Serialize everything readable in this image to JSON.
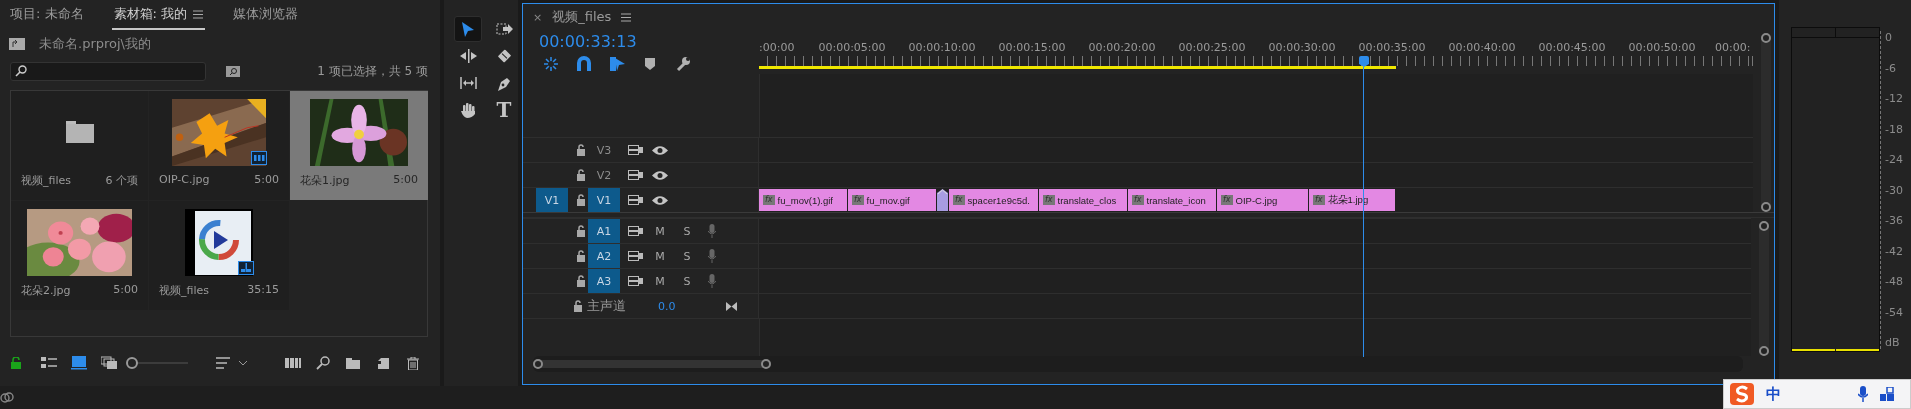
{
  "project_panel": {
    "tabs": [
      {
        "label": "项目: 未命名",
        "selected": false
      },
      {
        "label": "素材箱: 我的",
        "selected": true
      },
      {
        "label": "媒体浏览器",
        "selected": false
      }
    ],
    "path": "未命名.prproj\\我的",
    "selection_count": "1 项已选择，共 5 项",
    "items": [
      {
        "name": "视频_files",
        "info": "6 个项",
        "kind": "folder",
        "selected": false
      },
      {
        "name": "OIP-C.jpg",
        "info": "5:00",
        "kind": "clip",
        "selected": false
      },
      {
        "name": "花朵1.jpg",
        "info": "5:00",
        "selected": true
      },
      {
        "name": "花朵2.jpg",
        "info": "5:00",
        "selected": false
      },
      {
        "name": "视频_files",
        "info": "35:15",
        "kind": "sequence",
        "selected": false
      }
    ],
    "view_buttons": [
      {
        "kind": "list",
        "selected": false
      },
      {
        "kind": "icon",
        "selected": true
      },
      {
        "kind": "freeform",
        "selected": false
      }
    ],
    "zoom_slider": {
      "level": 0
    }
  },
  "tools": [
    {
      "kind": "selection",
      "selected": true
    },
    {
      "kind": "track_select",
      "selected": false
    },
    {
      "kind": "ripple",
      "selected": false
    },
    {
      "kind": "razor",
      "selected": false
    },
    {
      "kind": "slip",
      "selected": false
    },
    {
      "kind": "pen",
      "selected": false
    },
    {
      "kind": "hand",
      "selected": false
    },
    {
      "kind": "type",
      "glyph": "T",
      "selected": false
    }
  ],
  "timeline": {
    "tab": "视频_files",
    "close": "×",
    "timecode": "00:00:33:13",
    "toggles": [
      {
        "kind": "nest",
        "on": true
      },
      {
        "kind": "snap",
        "on": true
      },
      {
        "kind": "linked",
        "on": true
      },
      {
        "kind": "marker",
        "on": false
      },
      {
        "kind": "settings",
        "on": false
      }
    ],
    "ruler": [
      ":00:00",
      "00:00:05:00",
      "00:00:10:00",
      "00:00:15:00",
      "00:00:20:00",
      "00:00:25:00",
      "00:00:30:00",
      "00:00:35:00",
      "00:00:40:00",
      "00:00:45:00",
      "00:00:50:00",
      "00:00:"
    ],
    "video_tracks": [
      {
        "label": "V3",
        "targeted": false
      },
      {
        "label": "V2",
        "targeted": false
      },
      {
        "label": "V1",
        "source_patch": "V1",
        "targeted": true
      }
    ],
    "clips": [
      {
        "kind": "clip",
        "badge": "fx",
        "name": "fu_mov(1).gif"
      },
      {
        "kind": "clip",
        "badge": "fx",
        "name": "fu_mov.gif"
      },
      {
        "kind": "transition"
      },
      {
        "kind": "clip",
        "badge": "fx",
        "name": "spacer1e9c5d."
      },
      {
        "kind": "clip",
        "badge": "fx",
        "name": "translate_clos"
      },
      {
        "kind": "clip",
        "badge": "fx",
        "name": "translate_icon"
      },
      {
        "kind": "clip",
        "badge": "fx",
        "name": "OIP-C.jpg"
      },
      {
        "kind": "clip",
        "badge": "fx",
        "name": "花朵1.jpg"
      }
    ],
    "audio_tracks": [
      {
        "label": "A1",
        "targeted": true,
        "mute": "M",
        "solo": "S"
      },
      {
        "label": "A2",
        "targeted": true,
        "mute": "M",
        "solo": "S"
      },
      {
        "label": "A3",
        "targeted": true,
        "mute": "M",
        "solo": "S"
      }
    ],
    "master": {
      "label": "主声道",
      "value": "0.0"
    }
  },
  "audio_meter": {
    "scale": [
      "0",
      "-6",
      "-12",
      "-18",
      "-24",
      "-30",
      "-36",
      "-42",
      "-48",
      "-54",
      "dB"
    ]
  },
  "ime_bar": {
    "label": "中"
  }
}
